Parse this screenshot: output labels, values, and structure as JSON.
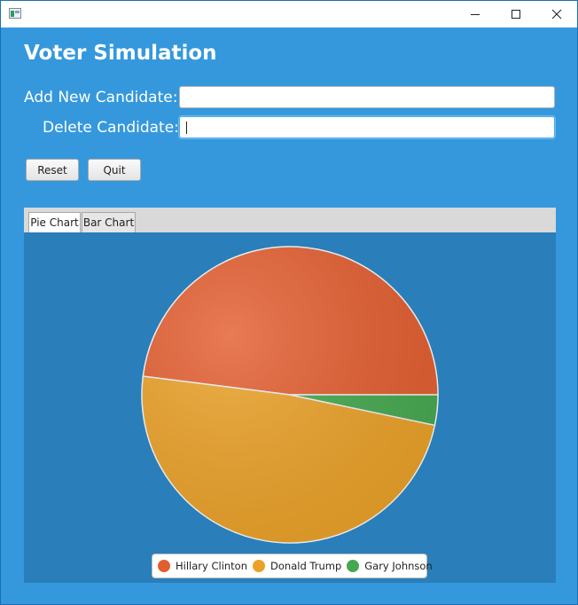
{
  "app": {
    "heading": "Voter Simulation"
  },
  "form": {
    "add_label": "Add New Candidate:",
    "add_value": "",
    "delete_label": "Delete Candidate:",
    "delete_value": ""
  },
  "buttons": {
    "reset_label": "Reset",
    "quit_label": "Quit"
  },
  "tabs": [
    {
      "label": "Pie Chart",
      "selected": true
    },
    {
      "label": "Bar Chart",
      "selected": false
    }
  ],
  "colors": {
    "window_bg": "#3598dc",
    "chart_bg": "#2a7eb9"
  },
  "icons": {
    "minimize": "minimize-icon",
    "maximize": "maximize-icon",
    "close": "close-icon"
  },
  "chart_data": {
    "type": "pie",
    "slices": [
      {
        "label": "Hillary Clinton",
        "value": 48,
        "color": "#e35d2f"
      },
      {
        "label": "Donald Trump",
        "value": 48.7,
        "color": "#eba127"
      },
      {
        "label": "Gary Johnson",
        "value": 3.3,
        "color": "#45a84f"
      }
    ],
    "legend_position": "bottom"
  }
}
